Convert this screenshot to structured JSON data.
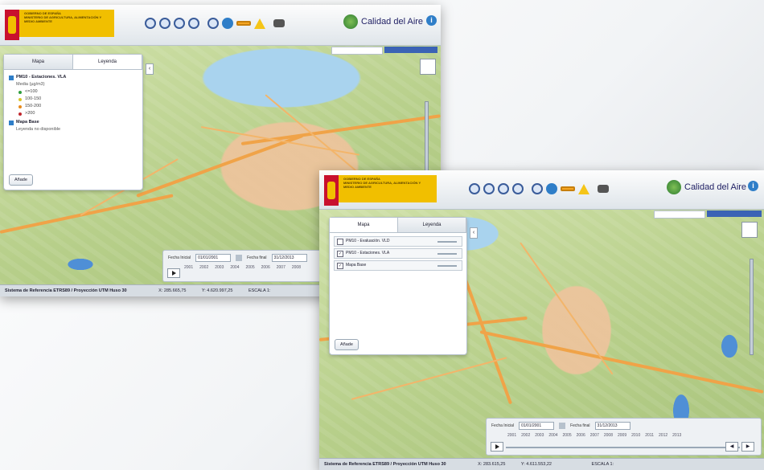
{
  "window1": {
    "gov_lines": [
      "GOBIERNO DE ESPAÑA",
      "MINISTERIO DE AGRICULTURA, ALIMENTACIÓN Y MEDIO AMBIENTE"
    ],
    "brand": "Calidad del Aire",
    "tabs": [
      "Mapa",
      "Leyenda"
    ],
    "legend": {
      "layer1": "PM10 - Estaciones. VLA",
      "subtitle": "Media (µg/m3)",
      "items": [
        {
          "label": "<=100",
          "color": "#2e9e3e"
        },
        {
          "label": "100-150",
          "color": "#d7c42a"
        },
        {
          "label": "150-200",
          "color": "#e88a1a"
        },
        {
          "label": ">200",
          "color": "#c0262d"
        }
      ],
      "layer2": "Mapa Base",
      "layer2_text": "Leyenda no disponible"
    },
    "add_button": "Añade",
    "date_from_label": "Fecha Inicial",
    "date_from": "01/01/2001",
    "date_to_label": "Fecha final",
    "date_to": "31/12/2013",
    "years": [
      "2001",
      "2002",
      "2003",
      "2004",
      "2005",
      "2006",
      "2007",
      "2008"
    ],
    "status": [
      "Sistema de Referencia ETRS89 / Proyección UTM Huso 30",
      "X: 285.665,75",
      "Y: 4.620.997,25",
      "ESCALA 1:"
    ]
  },
  "window2": {
    "gov_lines": [
      "GOBIERNO DE ESPAÑA",
      "MINISTERIO DE AGRICULTURA, ALIMENTACIÓN Y MEDIO AMBIENTE"
    ],
    "brand": "Calidad del Aire",
    "tabs": [
      "Mapa",
      "Leyenda"
    ],
    "layers": [
      {
        "label": "PM10 - Evaluación. VLD",
        "checked": false
      },
      {
        "label": "PM10 - Estaciones. VLA",
        "checked": true
      },
      {
        "label": "Mapa Base",
        "checked": true
      }
    ],
    "add_button": "Añade",
    "date_from_label": "Fecha Inicial",
    "date_from": "01/01/2001",
    "date_to_label": "Fecha final",
    "date_to": "31/12/2013",
    "years": [
      "2001",
      "2002",
      "2003",
      "2004",
      "2005",
      "2006",
      "2007",
      "2008",
      "2009",
      "2010",
      "2011",
      "2012",
      "2013"
    ],
    "status": [
      "Sistema de Referencia ETRS89 / Proyección UTM Huso 30",
      "X: 283.615,25",
      "Y: 4.611.553,22",
      "ESCALA 1:"
    ]
  }
}
